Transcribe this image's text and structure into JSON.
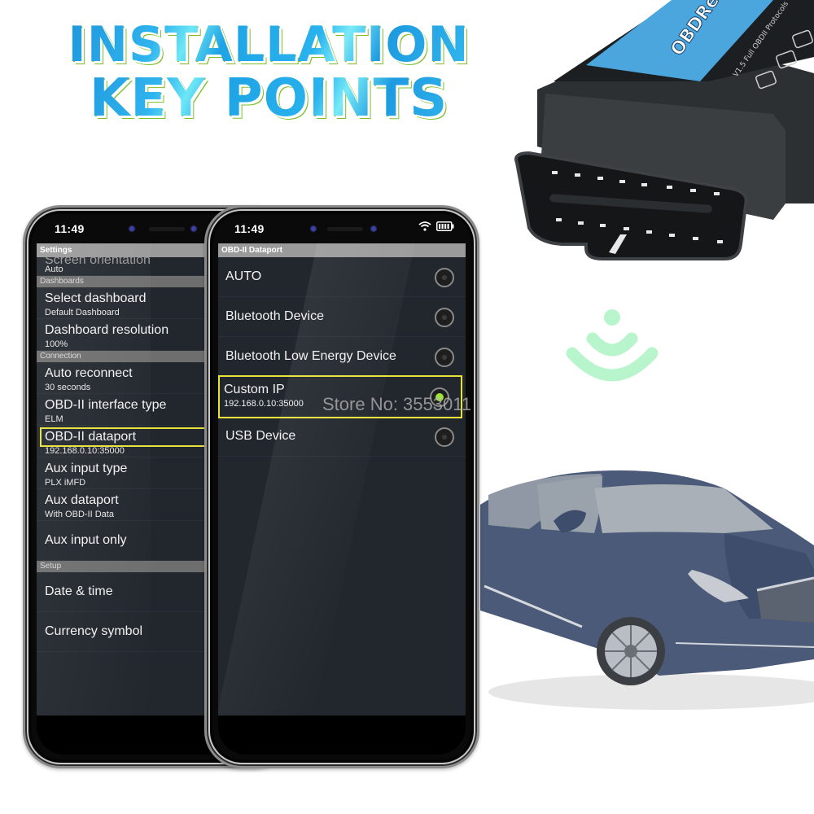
{
  "title": {
    "line1": "INSTALLATION",
    "line2": "KEY POINTS"
  },
  "product": {
    "label_brand": "OBDResource",
    "label_sub": "V1.5 Full OBDII Protocols"
  },
  "watermark": "Store No: 3553011",
  "colors": {
    "title_blue": "#1fa3e4",
    "highlight_yellow": "#e8e33a",
    "radio_selected": "#9fe23b",
    "signal_green": "#b9f5cc"
  },
  "phone_left": {
    "status_time": "11:49",
    "appbar_title": "Settings",
    "items": [
      {
        "type": "pref",
        "title": "Screen orientation",
        "summary": "Auto",
        "cut": true
      },
      {
        "type": "section",
        "title": "Dashboards"
      },
      {
        "type": "pref",
        "title": "Select dashboard",
        "summary": "Default Dashboard"
      },
      {
        "type": "pref",
        "title": "Dashboard resolution",
        "summary": "100%"
      },
      {
        "type": "section",
        "title": "Connection"
      },
      {
        "type": "pref",
        "title": "Auto reconnect",
        "summary": "30 seconds"
      },
      {
        "type": "pref",
        "title": "OBD-II interface type",
        "summary": "ELM"
      },
      {
        "type": "pref",
        "title": "OBD-II dataport",
        "summary": "192.168.0.10:35000",
        "highlighted": true
      },
      {
        "type": "pref",
        "title": "Aux input type",
        "summary": "PLX iMFD"
      },
      {
        "type": "pref",
        "title": "Aux dataport",
        "summary": "With OBD-II Data"
      },
      {
        "type": "pref",
        "title": "Aux input only",
        "summary": ""
      },
      {
        "type": "section",
        "title": "Setup"
      },
      {
        "type": "pref",
        "title": "Date & time",
        "summary": ""
      },
      {
        "type": "pref",
        "title": "Currency symbol",
        "summary": ""
      }
    ]
  },
  "phone_right": {
    "status_time": "11:49",
    "status_icons": [
      "wifi-icon",
      "battery-icon"
    ],
    "appbar_title": "OBD-II Dataport",
    "options": [
      {
        "label": "AUTO",
        "sub": "",
        "selected": false
      },
      {
        "label": "Bluetooth Device",
        "sub": "",
        "selected": false
      },
      {
        "label": "Bluetooth Low Energy Device",
        "sub": "",
        "selected": false
      },
      {
        "label": "Custom IP",
        "sub": "192.168.0.10:35000",
        "selected": true,
        "highlighted": true
      },
      {
        "label": "USB Device",
        "sub": "",
        "selected": false
      }
    ]
  }
}
